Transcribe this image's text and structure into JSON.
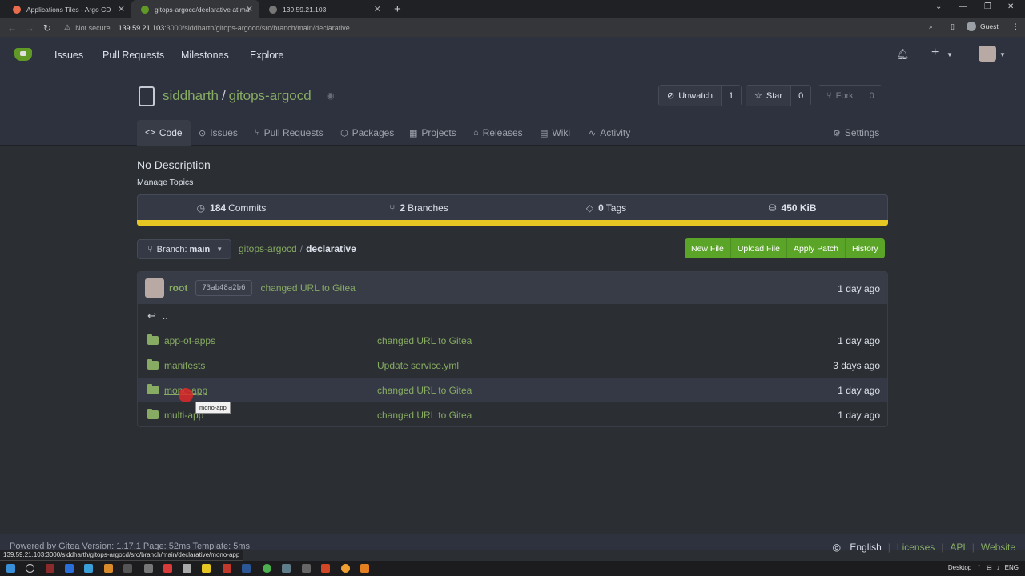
{
  "browser": {
    "tabs": [
      {
        "title": "Applications Tiles - Argo CD",
        "active": false
      },
      {
        "title": "gitops-argocd/declarative at ma",
        "active": true
      },
      {
        "title": "139.59.21.103",
        "active": false
      }
    ],
    "security_label": "Not secure",
    "url_host": "139.59.21.103",
    "url_path": ":3000/siddharth/gitops-argocd/src/branch/main/declarative",
    "profile_label": "Guest"
  },
  "gitea_nav": {
    "items": [
      "Issues",
      "Pull Requests",
      "Milestones",
      "Explore"
    ]
  },
  "repo": {
    "owner": "siddharth",
    "separator": "/",
    "name": "gitops-argocd",
    "watch": {
      "label": "Unwatch",
      "count": "1"
    },
    "star": {
      "label": "Star",
      "count": "0"
    },
    "fork": {
      "label": "Fork",
      "count": "0"
    },
    "tabs": [
      "Code",
      "Issues",
      "Pull Requests",
      "Packages",
      "Projects",
      "Releases",
      "Wiki",
      "Activity"
    ],
    "settings_label": "Settings",
    "description": "No Description",
    "manage_topics": "Manage Topics",
    "stats": {
      "commits": {
        "count": "184",
        "label": "Commits"
      },
      "branches": {
        "count": "2",
        "label": "Branches"
      },
      "tags": {
        "count": "0",
        "label": "Tags"
      },
      "size": "450 KiB"
    },
    "language_color": "#e6c623",
    "branch": {
      "prefix": "Branch:",
      "name": "main"
    },
    "breadcrumb": {
      "root": "gitops-argocd",
      "sep": "/",
      "current": "declarative"
    },
    "actions": [
      "New File",
      "Upload File",
      "Apply Patch",
      "History"
    ],
    "latest_commit": {
      "author": "root",
      "sha": "73ab48a2b6",
      "message": "changed URL to Gitea",
      "when": "1 day ago"
    },
    "parent_dir": "..",
    "files": [
      {
        "name": "app-of-apps",
        "message": "changed URL to Gitea",
        "when": "1 day ago"
      },
      {
        "name": "manifests",
        "message": "Update service.yml",
        "when": "3 days ago"
      },
      {
        "name": "mono-app",
        "message": "changed URL to Gitea",
        "when": "1 day ago"
      },
      {
        "name": "multi-app",
        "message": "changed URL to Gitea",
        "when": "1 day ago"
      }
    ],
    "tooltip": "mono-app"
  },
  "footer": {
    "powered": "Powered by Gitea Version: 1.17.1 Page: 52ms Template: 5ms",
    "language": "English",
    "links": [
      "Licenses",
      "API",
      "Website"
    ]
  },
  "status_url": "139.59.21.103:3000/siddharth/gitops-argocd/src/branch/main/declarative/mono-app",
  "taskbar": {
    "desktop_label": "Desktop",
    "lang": "ENG"
  },
  "colors": {
    "accent_green": "#87ab63",
    "button_green": "#5aa428",
    "background": "#2b2f33"
  }
}
